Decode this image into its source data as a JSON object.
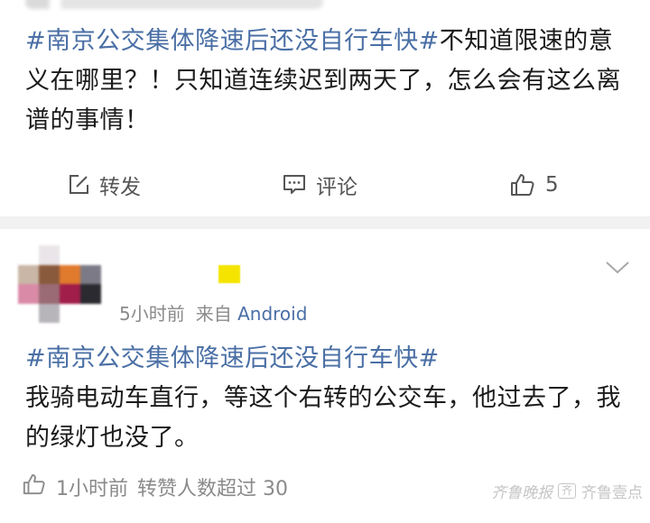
{
  "post1": {
    "hashtag": "#南京公交集体降速后还没自行车快#",
    "body": "不知道限速的意义在哪里？！只知道连续迟到两天了，怎么会有这么离谱的事情！",
    "actions": {
      "repost_label": "转发",
      "comment_label": "评论",
      "like_count": "5"
    }
  },
  "post2": {
    "meta_time": "5小时前",
    "meta_from": "来自",
    "meta_source": "Android",
    "hashtag": "#南京公交集体降速后还没自行车快#",
    "body": "我骑电动车直行，等这个右转的公交车，他过去了，我的绿灯也没了。",
    "footer_time": "1小时前",
    "footer_stats": "转赞人数超过 30"
  },
  "watermark": {
    "script_text": "齐鲁晚报",
    "logo_text": "齐鲁壹点"
  },
  "colors": {
    "link": "#4a6fa5",
    "text": "#1b1b1b",
    "muted": "#8a8a8a",
    "divider": "#f1f1f1"
  },
  "icons": [
    "repost-icon",
    "comment-icon",
    "like-icon",
    "chevron-down-icon"
  ]
}
